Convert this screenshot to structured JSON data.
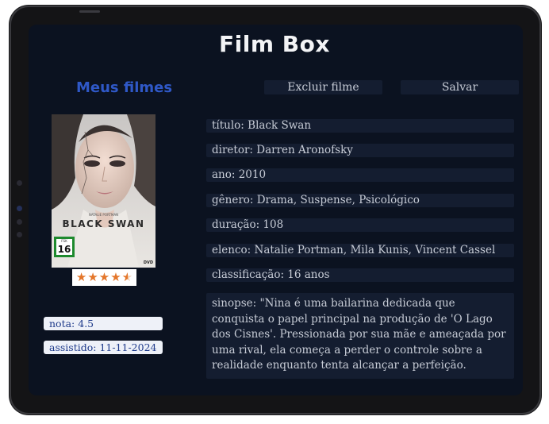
{
  "app": {
    "title": "Film Box"
  },
  "sidebar": {
    "heading": "Meus filmes"
  },
  "toolbar": {
    "delete_label": "Excluir filme",
    "save_label": "Salvar"
  },
  "poster": {
    "title_text": "BLACK SWAN",
    "credit_text": "NATALIE PORTMAN",
    "age_rating": "16",
    "fsk_label": "FSK",
    "dvd_label": "DVD"
  },
  "rating": {
    "stars_filled": 4.5,
    "stars_total": 5,
    "note_label": "nota: 4.5",
    "watched_label": "assistido: 11-11-2024"
  },
  "details": {
    "titulo": "título: Black Swan",
    "diretor": "diretor: Darren Aronofsky",
    "ano": "ano: 2010",
    "genero": "gênero: Drama, Suspense, Psicológico",
    "duracao": "duração: 108",
    "elenco": "elenco: Natalie Portman, Mila Kunis, Vincent Cassel",
    "classificacao": "classificação: 16 anos",
    "sinopse": "sinopse: \"Nina é uma bailarina dedicada que conquista o papel principal na produção de 'O Lago dos Cisnes'. Pressionada por sua mãe e ameaçada por uma rival, ela começa a perder o controle sobre a realidade enquanto tenta alcançar a perfeição."
  },
  "colors": {
    "accent": "#2f58c7",
    "screen_bg": "#0b1220",
    "field_bg": "#141d30",
    "star": "#e4762a"
  }
}
